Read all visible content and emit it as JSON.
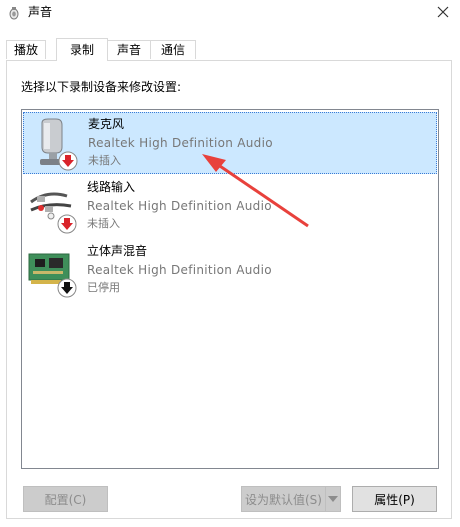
{
  "window": {
    "title": "声音",
    "title_icon": "speaker-icon",
    "close_icon": "close-icon"
  },
  "tabs": [
    {
      "label": "播放",
      "active": false
    },
    {
      "label": "录制",
      "active": true
    },
    {
      "label": "声音",
      "active": false
    },
    {
      "label": "通信",
      "active": false
    }
  ],
  "panel": {
    "instruction": "选择以下录制设备来修改设置:"
  },
  "devices": [
    {
      "name": "麦克风",
      "driver": "Realtek High Definition Audio",
      "status": "未插入",
      "icon": "microphone-icon",
      "badge": "red-down-arrow-icon",
      "selected": true
    },
    {
      "name": "线路输入",
      "driver": "Realtek High Definition Audio",
      "status": "未插入",
      "icon": "line-in-cable-icon",
      "badge": "red-down-arrow-icon",
      "selected": false
    },
    {
      "name": "立体声混音",
      "driver": "Realtek High Definition Audio",
      "status": "已停用",
      "icon": "sound-card-icon",
      "badge": "black-down-arrow-icon",
      "selected": false
    }
  ],
  "buttons": {
    "configure": "配置(C)",
    "set_default": "设为默认值(S)",
    "properties": "属性(P)"
  },
  "colors": {
    "selection": "#cce8ff",
    "annotation_arrow": "#e8413c",
    "status_red": "#d9232a"
  }
}
